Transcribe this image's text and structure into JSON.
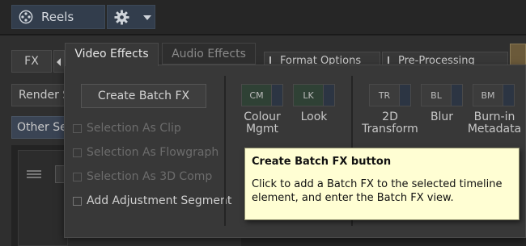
{
  "topbar": {
    "reels_label": "Reels",
    "reels_icon": "film-reel-icon",
    "settings_icon": "gear-icon",
    "settings_menu_icon": "chevron-down-icon"
  },
  "background": {
    "fx_label": "FX",
    "render_label": "Render S",
    "other_label": "Other Sec",
    "format_tab": "Format Options",
    "preprocess_tab": "Pre-Processing"
  },
  "panel": {
    "tabs": [
      {
        "label": "Video Effects",
        "active": true
      },
      {
        "label": "Audio Effects",
        "active": false
      }
    ],
    "create_batch_label": "Create Batch FX",
    "options": [
      {
        "label": "Selection As Clip",
        "enabled": false
      },
      {
        "label": "Selection As Flowgraph",
        "enabled": false
      },
      {
        "label": "Selection As 3D Comp",
        "enabled": false
      },
      {
        "label": "Add Adjustment Segment",
        "enabled": true
      }
    ],
    "effects": [
      {
        "tag": "CM",
        "label": "Colour Mgmt"
      },
      {
        "tag": "LK",
        "label": "Look"
      },
      {
        "tag": "TR",
        "label": "2D Transform"
      },
      {
        "tag": "BL",
        "label": "Blur"
      },
      {
        "tag": "BM",
        "label": "Burn-in Metadata"
      }
    ]
  },
  "tooltip": {
    "title": "Create Batch FX button",
    "text": "Click to add a Batch FX to the selected timeline element, and enter the Batch FX view."
  },
  "colors": {
    "tooltip_bg": "#fffed3",
    "button_blue": "#323d4c",
    "fx_green": "#2f4135"
  }
}
